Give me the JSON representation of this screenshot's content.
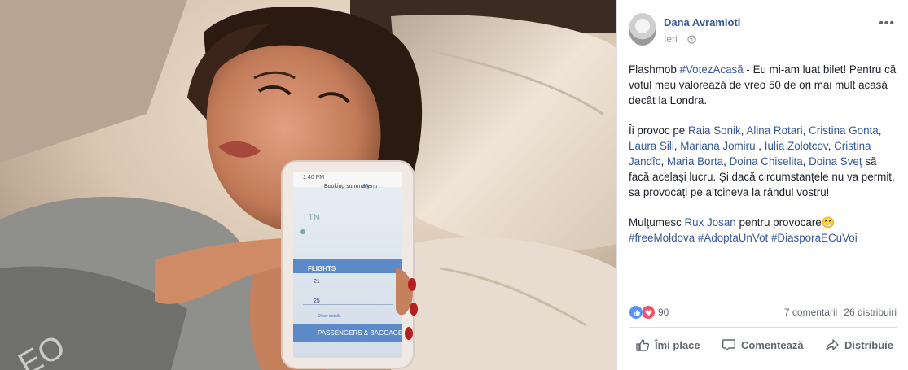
{
  "post": {
    "author": "Dana Avramioti",
    "time": "Ieri",
    "separator": "·",
    "more": "•••",
    "text": {
      "p1_prefix": "Flashmob ",
      "p1_tag": "#VotezAcasă",
      "p1_rest": " - Eu mi-am luat bilet! Pentru că votul meu valorează de vreo 50 de ori mai mult acasă decât la Londra.",
      "p2_prefix": "Îi provoc pe ",
      "mentions": [
        "Raia Sonik",
        "Alina Rotari",
        "Cristina Gonta",
        "Laura Sili",
        "Mariana Jomiru",
        "Iulia Zolotcov",
        "Cristina Jandîc",
        "Maria Borta",
        "Doina Chiselita",
        "Doina Șveț"
      ],
      "p2_rest": " să facă același lucru. Și dacă circumstanțele nu va permit, sa provocați pe altcineva la rândul vostru!",
      "p3_prefix": "Mulțumesc ",
      "p3_mention": "Rux Josan",
      "p3_rest": " pentru provocare😁",
      "hashtags": [
        "#freeMoldova",
        "#AdoptaUnVot",
        "#DiasporaECuVoi"
      ]
    },
    "reactions": {
      "count": "90",
      "comments": "7 comentarii",
      "shares": "26 distribuiri"
    },
    "actions": {
      "like": "Îmi place",
      "comment": "Comentează",
      "share": "Distribuie"
    }
  },
  "phone_screen": {
    "time": "1:40 PM",
    "title": "Booking summary",
    "menu": "Menu",
    "from": "LTN",
    "section": "FLIGHTS",
    "date1": "21",
    "date2": "25",
    "more": "Show details",
    "passengers": "PASSENGERS & BAGGAGE"
  },
  "colors": {
    "link": "#365899",
    "meta": "#90949c",
    "like_blue": "#5890ff",
    "love_red": "#f25268"
  }
}
